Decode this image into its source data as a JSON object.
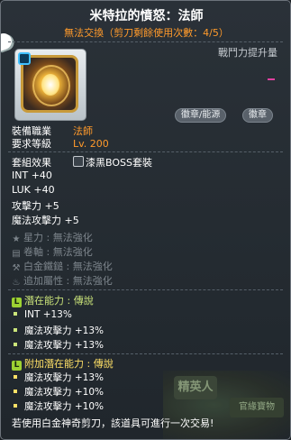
{
  "header": {
    "title": "米特拉的憤怒：法師",
    "subtitle": "無法交換（剪刀剩餘使用次數：4/5）",
    "power_label": "戰鬥力提升量"
  },
  "item": {
    "icon": "mitra-rage-emblem-icon",
    "tags": [
      "徽章/能源",
      "徽章"
    ],
    "requirements": [
      {
        "key": "裝備職業",
        "value": "法師"
      },
      {
        "key": "要求等級",
        "value": "Lv. 200"
      }
    ]
  },
  "set": {
    "key": "套組效果",
    "value": "漆黑BOSS套裝"
  },
  "stats": [
    {
      "key": "INT",
      "value": "+40"
    },
    {
      "key": "LUK",
      "value": "+40"
    },
    {
      "key": "攻擊力",
      "value": "+5"
    },
    {
      "key": "魔法攻擊力",
      "value": "+5"
    }
  ],
  "enhancements": [
    {
      "icon": "star-icon",
      "label": "星力",
      "value": "無法強化"
    },
    {
      "icon": "scroll-icon",
      "label": "卷軸",
      "value": "無法強化"
    },
    {
      "icon": "hammer-icon",
      "label": "白金鐵鎚",
      "value": "無法強化"
    },
    {
      "icon": "flame-icon",
      "label": "追加屬性",
      "value": "無法強化"
    }
  ],
  "potential": {
    "badge": "L",
    "title": "潛在能力",
    "grade": "傳說",
    "lines": [
      "INT +13%",
      "魔法攻擊力 +13%",
      "魔法攻擊力 +13%"
    ]
  },
  "additional_potential": {
    "badge": "L",
    "title": "附加潛在能力",
    "grade": "傳說",
    "lines": [
      "魔法攻擊力 +13%",
      "魔法攻擊力 +10%",
      "魔法攻擊力 +10%"
    ]
  },
  "background": {
    "npc_text": "精英人",
    "sign_text": "官緣寶物"
  },
  "footer": "若使用白金神奇剪刀，該道具可進行一次交易!",
  "colors": {
    "orange": "#ff9a2b",
    "legendary_green": "#9dd232",
    "gray": "#7d858c"
  }
}
